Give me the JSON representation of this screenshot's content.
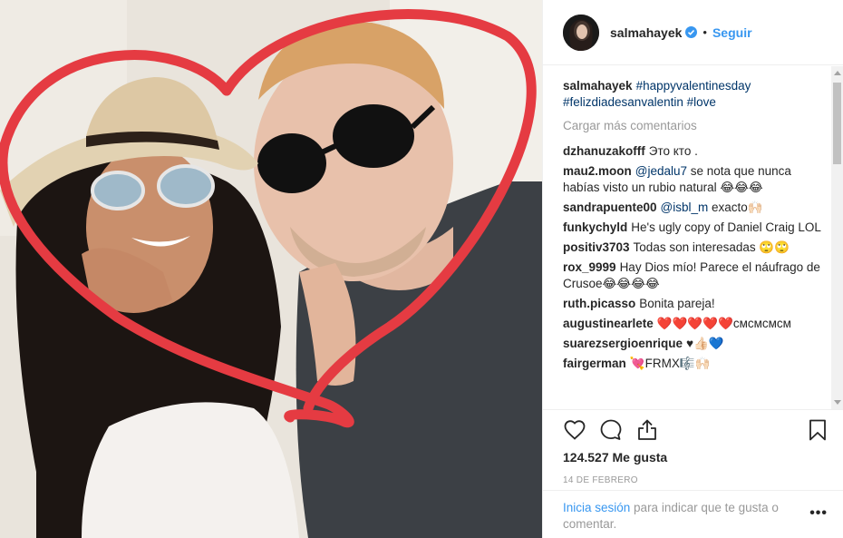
{
  "post": {
    "username": "salmahayek",
    "verified_icon": "verified-badge-icon",
    "follow_label": "Seguir",
    "separator": "•",
    "caption_user": "salmahayek",
    "caption_tags": "#happyvalentinesday #felizdiadesanvalentin #love",
    "load_more": "Cargar más comentarios",
    "comments": [
      {
        "user": "dzhanuzakofff",
        "text": "Это кто ."
      },
      {
        "user": "mau2.moon",
        "mention": "@jedalu7",
        "text": " se nota que nunca habías visto un rubio natural 😂😂😂"
      },
      {
        "user": "sandrapuente00",
        "mention": "@isbl_m",
        "text": " exacto🙌🏻"
      },
      {
        "user": "funkychyld",
        "text": "He's ugly copy of Daniel Craig LOL"
      },
      {
        "user": "positiv3703",
        "text": "Todas son interesadas 🙄🙄"
      },
      {
        "user": "rox_9999",
        "text": "Hay Dios mío! Parece el náufrago de Crusoe😂😂😂😂"
      },
      {
        "user": "ruth.picasso",
        "text": "Bonita pareja!"
      },
      {
        "user": "augustinearlete",
        "text": "❤️❤️❤️❤️❤️cмcмcмcм"
      },
      {
        "user": "suarezsergioenrique",
        "text": "♥👍🏻💙"
      },
      {
        "user": "fairgerman",
        "text": "💘FRMX🎼🙌🏻"
      }
    ],
    "likes": "124.527 Me gusta",
    "date": "14 DE FEBRERO",
    "login_link": "Inicia sesión",
    "login_text": " para indicar que te gusta o comentar.",
    "more_label": "•••",
    "icons": {
      "like": "heart-icon",
      "comment": "comment-icon",
      "share": "share-icon",
      "save": "bookmark-icon"
    },
    "colors": {
      "accent": "#3897f0",
      "heart_frame": "#e53b42",
      "text": "#262626",
      "muted": "#999999"
    }
  }
}
